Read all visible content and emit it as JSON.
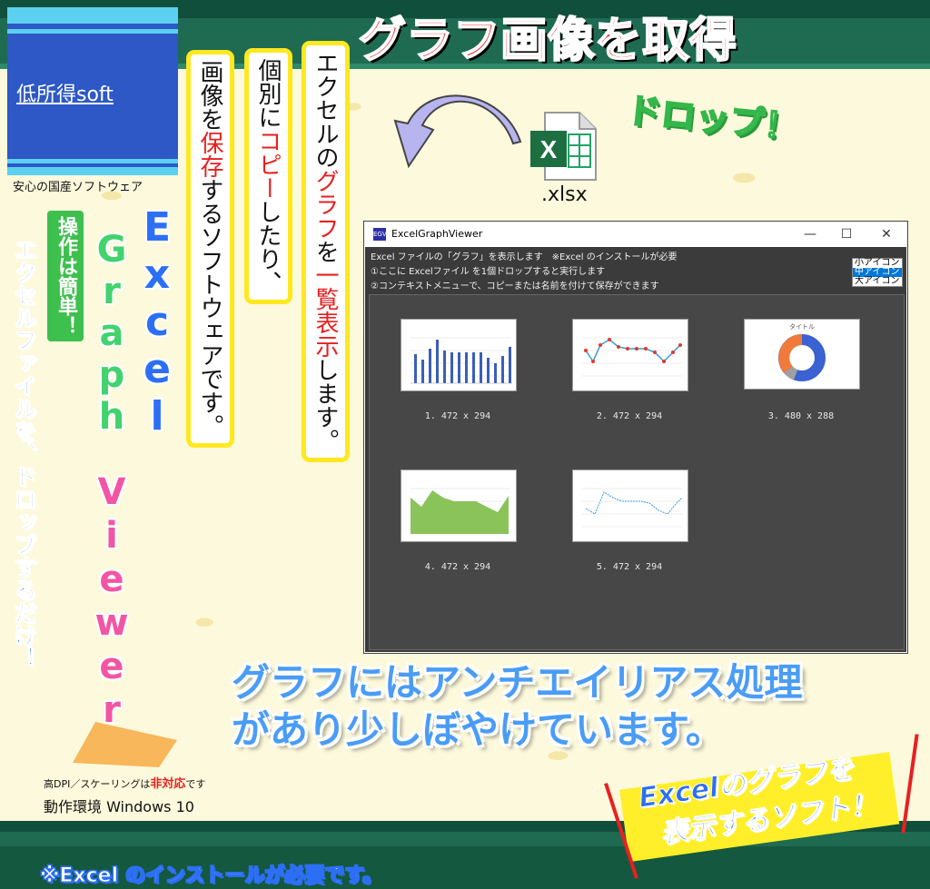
{
  "brand": {
    "logo_text": "低所得soft",
    "tagline": "安心の国産ソフトウェア"
  },
  "headline": "グラフ画像を取得",
  "vertical_copy": {
    "col1": [
      "エクセルの",
      "グラフ",
      "を",
      "一覧表示",
      "します。"
    ],
    "col2": [
      "個別に",
      "コピー",
      "したり、"
    ],
    "col3": [
      "画像を",
      "保存",
      "するソフトウェアです。"
    ]
  },
  "product_name": {
    "excel": [
      "E",
      "x",
      "c",
      "e",
      "l"
    ],
    "graph": [
      "G",
      "r",
      "a",
      "p",
      "h"
    ],
    "viewer": [
      "V",
      "i",
      "e",
      "w",
      "e",
      "r"
    ]
  },
  "easy_badge": "操作は簡単！",
  "drop_only": "エクセルファイルを、ドロップするだけ！",
  "drop_callout": "ドロップ！",
  "file_ext": ".xlsx",
  "window": {
    "title": "ExcelGraphViewer",
    "app_icon": "EGV",
    "minimize": "—",
    "maximize": "☐",
    "close": "✕",
    "info_lines": [
      "Excel ファイルの「グラフ」を表示します　※Excel のインストールが必要",
      "①ここに Excelファイル を1個ドロップすると実行します",
      "②コンテキストメニューで、コピーまたは名前を付けて保存ができます"
    ],
    "icon_sizes": [
      {
        "label": "小アイコン",
        "selected": false
      },
      {
        "label": "中アイコン",
        "selected": true
      },
      {
        "label": "大アイコン",
        "selected": false
      }
    ],
    "thumbnails": [
      {
        "caption": "1. 472 x 294",
        "kind": "bar"
      },
      {
        "caption": "2. 472 x 294",
        "kind": "line"
      },
      {
        "caption": "3. 480 x 288",
        "kind": "donut",
        "title": "タイトル"
      },
      {
        "caption": "4. 472 x 294",
        "kind": "area"
      },
      {
        "caption": "5. 472 x 294",
        "kind": "line2"
      }
    ]
  },
  "blur_note": [
    "グラフにはアンチエイリアス処理",
    "があり少しぼやけています。"
  ],
  "sticker": [
    "Excelのグラフを",
    "表示するソフト！"
  ],
  "dpi_note": {
    "prefix": "高DPI／スケーリングは",
    "emph": "非対応",
    "suffix": "です"
  },
  "environment": "動作環境 Windows 10",
  "install_note": "※Excel のインストールが必要です。",
  "colors": {
    "accent_red": "#e82020",
    "accent_blue": "#2c6ff5",
    "accent_green": "#42d36e",
    "accent_pink": "#f255a4",
    "highlight": "#ffe820"
  }
}
